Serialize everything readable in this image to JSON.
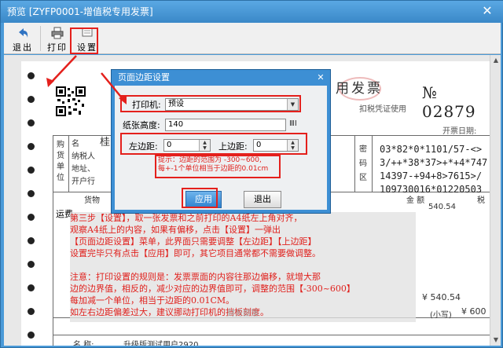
{
  "window": {
    "title": "预览 [ZYFP0001-增值税专用发票]",
    "close_glyph": "✕"
  },
  "toolbar": {
    "exit_label": "退出",
    "print_label": "打印",
    "settings_label": "设置"
  },
  "invoice": {
    "title": "用发票",
    "subtitle": "扣税凭证使用",
    "number": "№ 02879",
    "date_label": "开票日期:",
    "buyer_side": [
      "购",
      "货",
      "单",
      "位"
    ],
    "buyer_fields": [
      "名",
      "纳税人",
      "地址、",
      "开户行"
    ],
    "buyer_name_partial": "桂",
    "cipher_side": [
      "密",
      "码",
      "区"
    ],
    "cipher_lines": [
      "03*82*0*1101/57-<>",
      "3/++*38*37>+*+4*747",
      "14397-+94+8>7615>/",
      "109730016*01220503"
    ],
    "goods_header": "货物",
    "amount_header": "金 额",
    "tax_header": "税",
    "row_item": "运费",
    "row_amount": "540.54",
    "row_tax": "税",
    "total_amount": "¥ 540.54",
    "capital_label": "(小写)",
    "capital_amount": "¥ 600",
    "seller_row": "名  称:",
    "seller_name": "升级版测试用户2920"
  },
  "note": {
    "lines": [
      "第三步【设置】，取一张发票和之前打印的A4纸左上角对齐，",
      "观察A4纸上的内容，如果有偏移，点击【设置】一弹出",
      "【页面边距设置】菜单，此界面只需要调整【左边距】【上边距】",
      "设置完毕只有点击【应用】即可，其它项目通常都不需要做调整。",
      "",
      "注意：打印设置的规则是：发票票面的内容往那边偏移，就增大那",
      "边的边界值，相反的，减少对应的边界值即可，调整的范围【-300~600】",
      "每加减一个单位，相当于边距的0.01CM。",
      "如左右边距偏差过大，建议挪动打印机的挡板刻度。"
    ],
    "watermark": "财务部落"
  },
  "dialog": {
    "title": "页面边距设置",
    "close_glyph": "✕",
    "printer_label": "打印机:",
    "printer_value": "预设",
    "paper_height_label": "纸张高度:",
    "paper_height_value": "140",
    "left_margin_label": "左边距:",
    "left_margin_value": "0",
    "top_margin_label": "上边距:",
    "top_margin_value": "0",
    "hint_line1": "提示：边距的范围为 -300~600,",
    "hint_line2": "每+-1个单位相当于边距的0.01cm",
    "apply_label": "应用",
    "exit_label": "退出"
  },
  "colors": {
    "accent": "#3d8fd4",
    "annotation_red": "#e4201c"
  }
}
